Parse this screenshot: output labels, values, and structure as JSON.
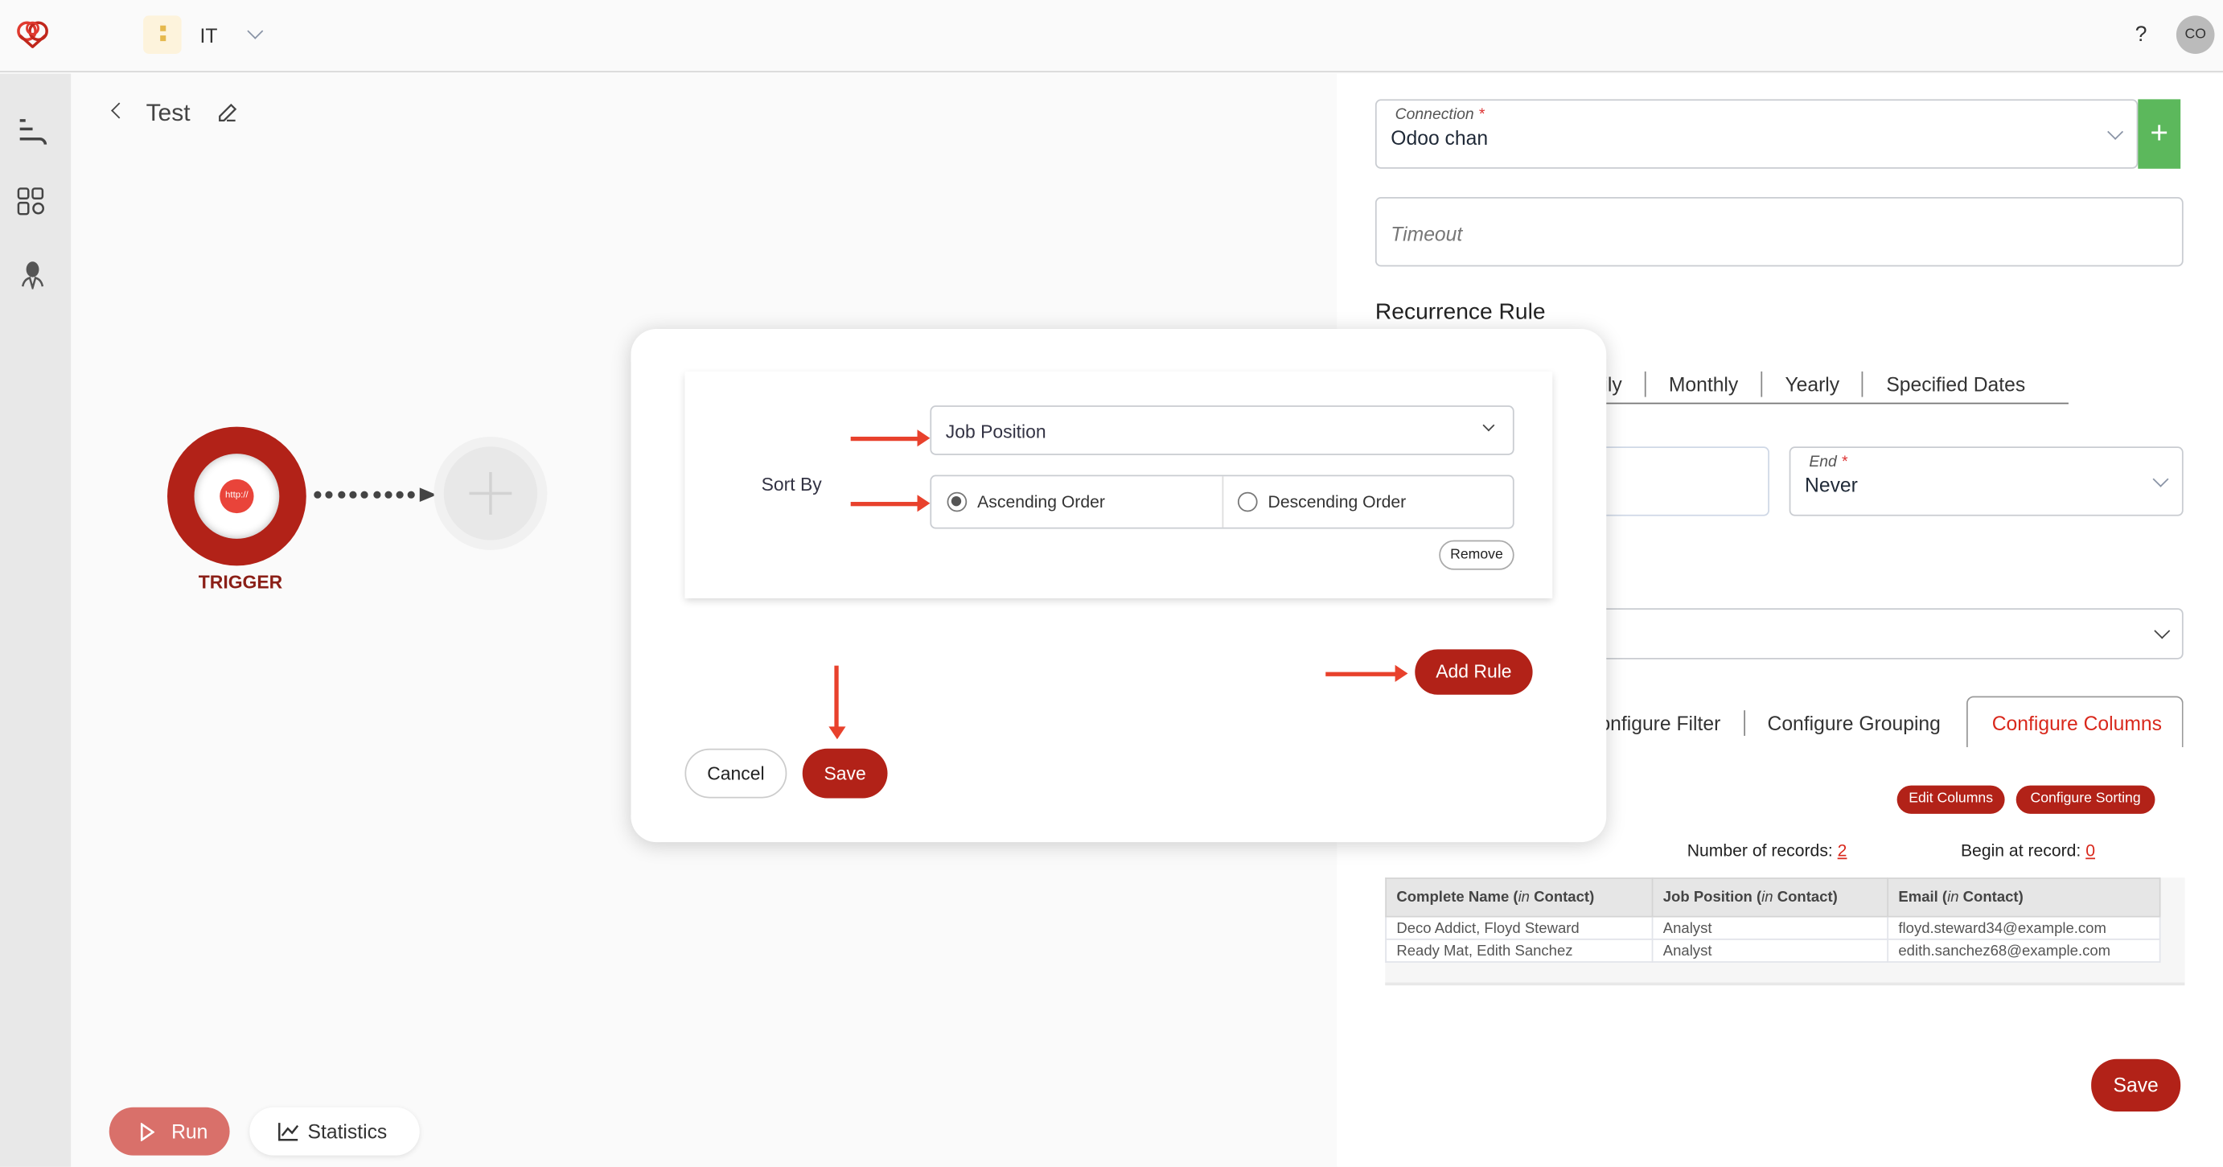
{
  "header": {
    "workspace": "IT",
    "help": "?",
    "avatar": "CO",
    "logo": "heart-knot-logo"
  },
  "flow": {
    "title": "Test",
    "trigger_label": "TRIGGER",
    "trigger_badge": "http://"
  },
  "bottom": {
    "run": "Run",
    "statistics": "Statistics"
  },
  "panel": {
    "connection_label": "Connection",
    "connection_value": "Odoo chan",
    "required": "*",
    "timeout_placeholder": "Timeout",
    "recurrence_title": "Recurrence Rule",
    "recurrence_tabs": [
      "aily",
      "Monthly",
      "Yearly",
      "Specified Dates"
    ],
    "end_label": "End",
    "end_value": "Never",
    "config_tabs": [
      "onfigure Filter",
      "Configure Grouping",
      "Configure Columns"
    ],
    "edit_columns": "Edit Columns",
    "configure_sorting": "Configure Sorting",
    "records_label": "Number of records:",
    "records_value": "2",
    "begin_label": "Begin at record:",
    "begin_value": "0",
    "table": {
      "headers": [
        {
          "name": "Complete Name",
          "in": "in",
          "model": "Contact"
        },
        {
          "name": "Job Position",
          "in": "in",
          "model": "Contact"
        },
        {
          "name": "Email",
          "in": "in",
          "model": "Contact"
        }
      ],
      "rows": [
        [
          "Deco Addict, Floyd Steward",
          "Analyst",
          "floyd.steward34@example.com"
        ],
        [
          "Ready Mat, Edith Sanchez",
          "Analyst",
          "edith.sanchez68@example.com"
        ]
      ]
    },
    "save": "Save"
  },
  "modal": {
    "sort_by": "Sort By",
    "field": "Job Position",
    "asc": "Ascending Order",
    "desc": "Descending Order",
    "selected": "asc",
    "remove": "Remove",
    "add_rule": "Add Rule",
    "cancel": "Cancel",
    "save": "Save"
  },
  "colors": {
    "brand": "#b22218",
    "accent_green": "#5cb85c",
    "annotation_arrow": "#e8412c"
  }
}
